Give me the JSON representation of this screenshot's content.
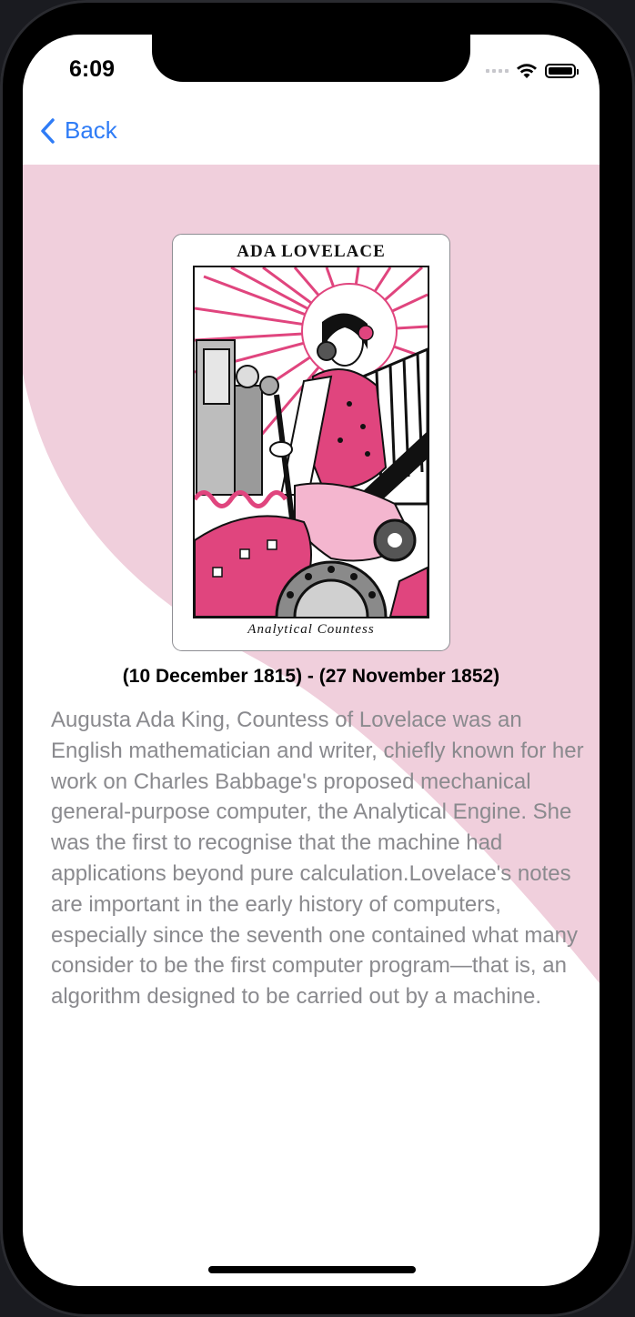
{
  "status_bar": {
    "time": "6:09"
  },
  "nav": {
    "back_label": "Back"
  },
  "card": {
    "title": "ADA LOVELACE",
    "caption": "Analytical Countess",
    "art_description_icon": "ada-lovelace-portrait"
  },
  "person": {
    "dates": "(10 December 1815) - (27 November 1852)",
    "bio": "Augusta Ada King, Countess of Lovelace was an English mathematician and writer, chiefly known for her work on Charles Babbage's proposed mechanical general-purpose computer, the Analytical Engine. She was the first to recognise that the machine had applications beyond pure calculation.Lovelace's notes are important in the early history of computers, especially since the seventh one contained what many consider to be the first computer program—that is, an algorithm designed to be carried out by a machine."
  },
  "colors": {
    "accent": "#2f7cf6",
    "background_shape": "#f0cfdc",
    "card_pink": "#e0457e",
    "body_text": "#8a8a8e"
  }
}
